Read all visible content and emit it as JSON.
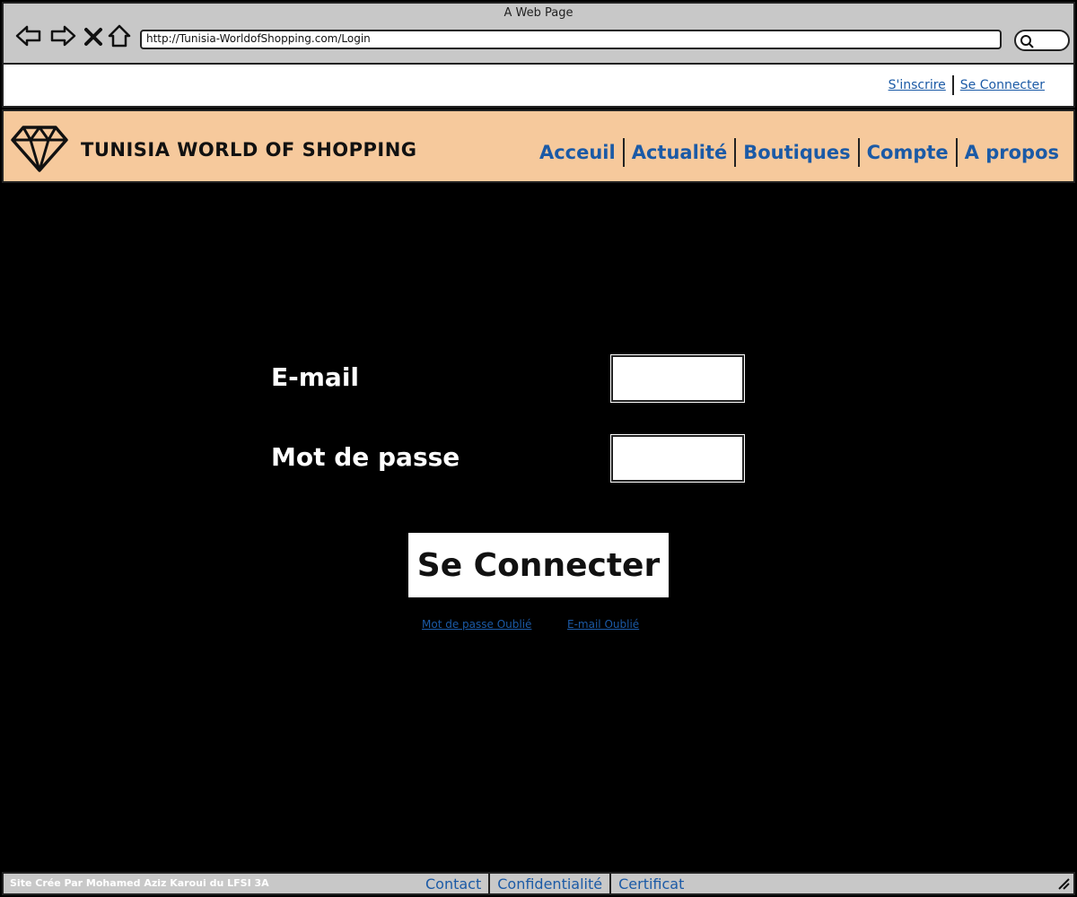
{
  "browser": {
    "window_title": "A Web Page",
    "url": "http://Tunisia-WorldofShopping.com/Login"
  },
  "authbar": {
    "signup_label": "S'inscrire",
    "login_label": "Se Connecter"
  },
  "header": {
    "site_title": "TUNISIA WORLD OF SHOPPING",
    "nav": [
      "Acceuil",
      "Actualité",
      "Boutiques",
      "Compte",
      "A propos"
    ]
  },
  "login": {
    "email_label": "E-mail",
    "password_label": "Mot de passe",
    "email_value": "",
    "password_value": "",
    "submit_label": "Se Connecter",
    "forgot_password": "Mot de passe Oublié",
    "forgot_email": "E-mail Oublié"
  },
  "footer": {
    "credit": "Site Crée Par Mohamed Aziz Karoui du LFSI 3A",
    "links": [
      "Contact",
      "Confidentialité",
      "Certificat"
    ]
  },
  "colors": {
    "header_bg": "#f6c99c",
    "link": "#1b5aa6",
    "page_bg": "#000000",
    "chrome": "#c8c8c8"
  }
}
